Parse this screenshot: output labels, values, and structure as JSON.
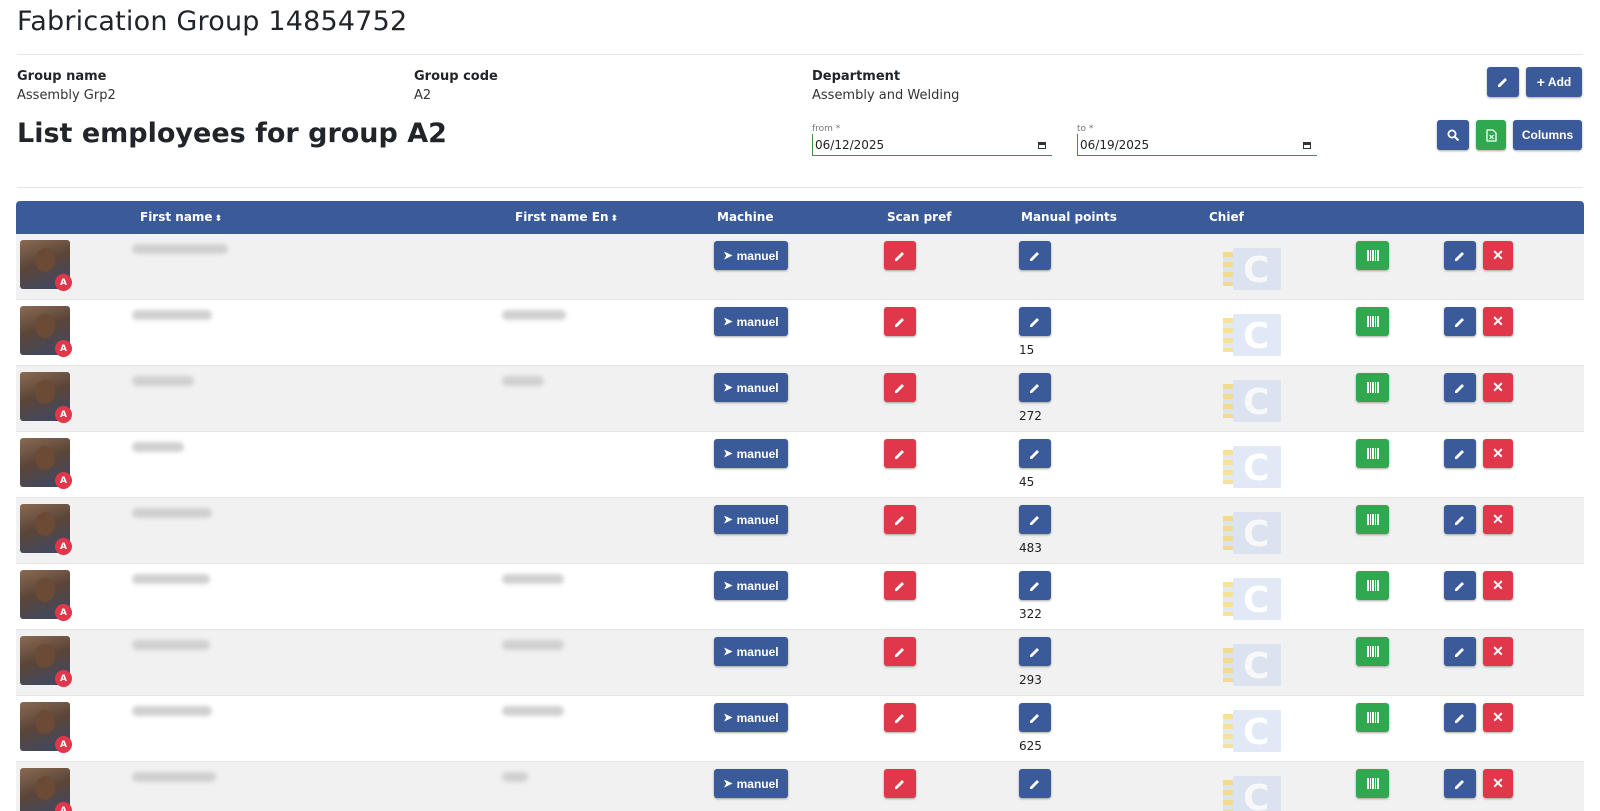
{
  "page": {
    "title": "Fabrication Group 14854752"
  },
  "group_info": {
    "name_label": "Group name",
    "name_value": "Assembly Grp2",
    "code_label": "Group code",
    "code_value": "A2",
    "dept_label": "Department",
    "dept_value": "Assembly and Welding"
  },
  "header_actions": {
    "add_label": "Add"
  },
  "list": {
    "title": "List employees for group A2",
    "from_label": "from *",
    "from_value": "06/12/2025",
    "to_label": "to *",
    "to_value": "06/19/2025",
    "columns_label": "Columns"
  },
  "table": {
    "headers": {
      "first_name": "First name",
      "first_name_en": "First name En",
      "machine": "Machine",
      "scan_pref": "Scan pref",
      "manual_points": "Manual points",
      "chief": "Chief"
    },
    "manuel_label": "manuel",
    "badge_label": "A",
    "rows": [
      {
        "manual_points": "",
        "has_en_name": false
      },
      {
        "manual_points": "15",
        "has_en_name": true
      },
      {
        "manual_points": "272",
        "has_en_name": true
      },
      {
        "manual_points": "45",
        "has_en_name": false
      },
      {
        "manual_points": "483",
        "has_en_name": false
      },
      {
        "manual_points": "322",
        "has_en_name": true
      },
      {
        "manual_points": "293",
        "has_en_name": true
      },
      {
        "manual_points": "625",
        "has_en_name": true
      },
      {
        "manual_points": "",
        "has_en_name": true
      }
    ]
  },
  "colors": {
    "primary": "#3a5a99",
    "success": "#2fa84f",
    "danger": "#e0374b"
  }
}
